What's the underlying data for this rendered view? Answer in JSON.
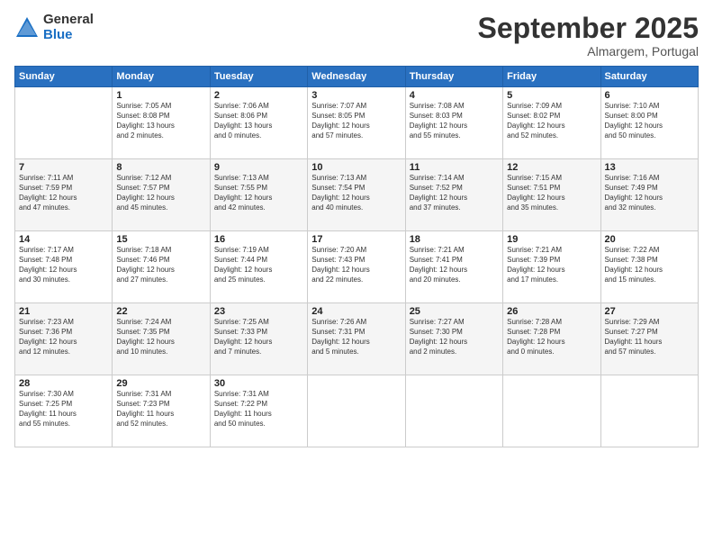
{
  "header": {
    "logo_general": "General",
    "logo_blue": "Blue",
    "month": "September 2025",
    "location": "Almargem, Portugal"
  },
  "weekdays": [
    "Sunday",
    "Monday",
    "Tuesday",
    "Wednesday",
    "Thursday",
    "Friday",
    "Saturday"
  ],
  "weeks": [
    [
      {
        "day": "",
        "info": ""
      },
      {
        "day": "1",
        "info": "Sunrise: 7:05 AM\nSunset: 8:08 PM\nDaylight: 13 hours\nand 2 minutes."
      },
      {
        "day": "2",
        "info": "Sunrise: 7:06 AM\nSunset: 8:06 PM\nDaylight: 13 hours\nand 0 minutes."
      },
      {
        "day": "3",
        "info": "Sunrise: 7:07 AM\nSunset: 8:05 PM\nDaylight: 12 hours\nand 57 minutes."
      },
      {
        "day": "4",
        "info": "Sunrise: 7:08 AM\nSunset: 8:03 PM\nDaylight: 12 hours\nand 55 minutes."
      },
      {
        "day": "5",
        "info": "Sunrise: 7:09 AM\nSunset: 8:02 PM\nDaylight: 12 hours\nand 52 minutes."
      },
      {
        "day": "6",
        "info": "Sunrise: 7:10 AM\nSunset: 8:00 PM\nDaylight: 12 hours\nand 50 minutes."
      }
    ],
    [
      {
        "day": "7",
        "info": "Sunrise: 7:11 AM\nSunset: 7:59 PM\nDaylight: 12 hours\nand 47 minutes."
      },
      {
        "day": "8",
        "info": "Sunrise: 7:12 AM\nSunset: 7:57 PM\nDaylight: 12 hours\nand 45 minutes."
      },
      {
        "day": "9",
        "info": "Sunrise: 7:13 AM\nSunset: 7:55 PM\nDaylight: 12 hours\nand 42 minutes."
      },
      {
        "day": "10",
        "info": "Sunrise: 7:13 AM\nSunset: 7:54 PM\nDaylight: 12 hours\nand 40 minutes."
      },
      {
        "day": "11",
        "info": "Sunrise: 7:14 AM\nSunset: 7:52 PM\nDaylight: 12 hours\nand 37 minutes."
      },
      {
        "day": "12",
        "info": "Sunrise: 7:15 AM\nSunset: 7:51 PM\nDaylight: 12 hours\nand 35 minutes."
      },
      {
        "day": "13",
        "info": "Sunrise: 7:16 AM\nSunset: 7:49 PM\nDaylight: 12 hours\nand 32 minutes."
      }
    ],
    [
      {
        "day": "14",
        "info": "Sunrise: 7:17 AM\nSunset: 7:48 PM\nDaylight: 12 hours\nand 30 minutes."
      },
      {
        "day": "15",
        "info": "Sunrise: 7:18 AM\nSunset: 7:46 PM\nDaylight: 12 hours\nand 27 minutes."
      },
      {
        "day": "16",
        "info": "Sunrise: 7:19 AM\nSunset: 7:44 PM\nDaylight: 12 hours\nand 25 minutes."
      },
      {
        "day": "17",
        "info": "Sunrise: 7:20 AM\nSunset: 7:43 PM\nDaylight: 12 hours\nand 22 minutes."
      },
      {
        "day": "18",
        "info": "Sunrise: 7:21 AM\nSunset: 7:41 PM\nDaylight: 12 hours\nand 20 minutes."
      },
      {
        "day": "19",
        "info": "Sunrise: 7:21 AM\nSunset: 7:39 PM\nDaylight: 12 hours\nand 17 minutes."
      },
      {
        "day": "20",
        "info": "Sunrise: 7:22 AM\nSunset: 7:38 PM\nDaylight: 12 hours\nand 15 minutes."
      }
    ],
    [
      {
        "day": "21",
        "info": "Sunrise: 7:23 AM\nSunset: 7:36 PM\nDaylight: 12 hours\nand 12 minutes."
      },
      {
        "day": "22",
        "info": "Sunrise: 7:24 AM\nSunset: 7:35 PM\nDaylight: 12 hours\nand 10 minutes."
      },
      {
        "day": "23",
        "info": "Sunrise: 7:25 AM\nSunset: 7:33 PM\nDaylight: 12 hours\nand 7 minutes."
      },
      {
        "day": "24",
        "info": "Sunrise: 7:26 AM\nSunset: 7:31 PM\nDaylight: 12 hours\nand 5 minutes."
      },
      {
        "day": "25",
        "info": "Sunrise: 7:27 AM\nSunset: 7:30 PM\nDaylight: 12 hours\nand 2 minutes."
      },
      {
        "day": "26",
        "info": "Sunrise: 7:28 AM\nSunset: 7:28 PM\nDaylight: 12 hours\nand 0 minutes."
      },
      {
        "day": "27",
        "info": "Sunrise: 7:29 AM\nSunset: 7:27 PM\nDaylight: 11 hours\nand 57 minutes."
      }
    ],
    [
      {
        "day": "28",
        "info": "Sunrise: 7:30 AM\nSunset: 7:25 PM\nDaylight: 11 hours\nand 55 minutes."
      },
      {
        "day": "29",
        "info": "Sunrise: 7:31 AM\nSunset: 7:23 PM\nDaylight: 11 hours\nand 52 minutes."
      },
      {
        "day": "30",
        "info": "Sunrise: 7:31 AM\nSunset: 7:22 PM\nDaylight: 11 hours\nand 50 minutes."
      },
      {
        "day": "",
        "info": ""
      },
      {
        "day": "",
        "info": ""
      },
      {
        "day": "",
        "info": ""
      },
      {
        "day": "",
        "info": ""
      }
    ]
  ]
}
